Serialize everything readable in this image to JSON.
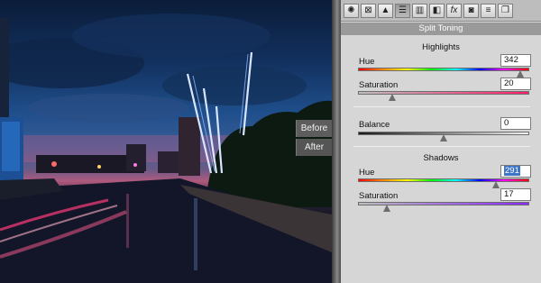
{
  "photo": {
    "before_label": "Before",
    "after_label": "After"
  },
  "panel": {
    "title": "Split Toning",
    "toolbar_icons": [
      "aperture-icon",
      "curve-icon",
      "triangle-icon",
      "split-toning-icon",
      "detail-icon",
      "fx-icon",
      "camera-icon",
      "presets-icon",
      "snapshots-icon"
    ],
    "highlights": {
      "heading": "Highlights",
      "hue_label": "Hue",
      "hue_value": "342",
      "hue_level": 0.95,
      "saturation_label": "Saturation",
      "saturation_value": "20",
      "saturation_level": 0.2
    },
    "balance": {
      "label": "Balance",
      "value": "0",
      "level": 0.5
    },
    "shadows": {
      "heading": "Shadows",
      "hue_label": "Hue",
      "hue_value": "291",
      "hue_level": 0.81,
      "saturation_label": "Saturation",
      "saturation_value": "17",
      "saturation_level": 0.17
    }
  },
  "colors": {
    "panel_bg": "#d6d6d6",
    "title_bar": "#9a9a9a",
    "selection": "#3b74c9"
  }
}
